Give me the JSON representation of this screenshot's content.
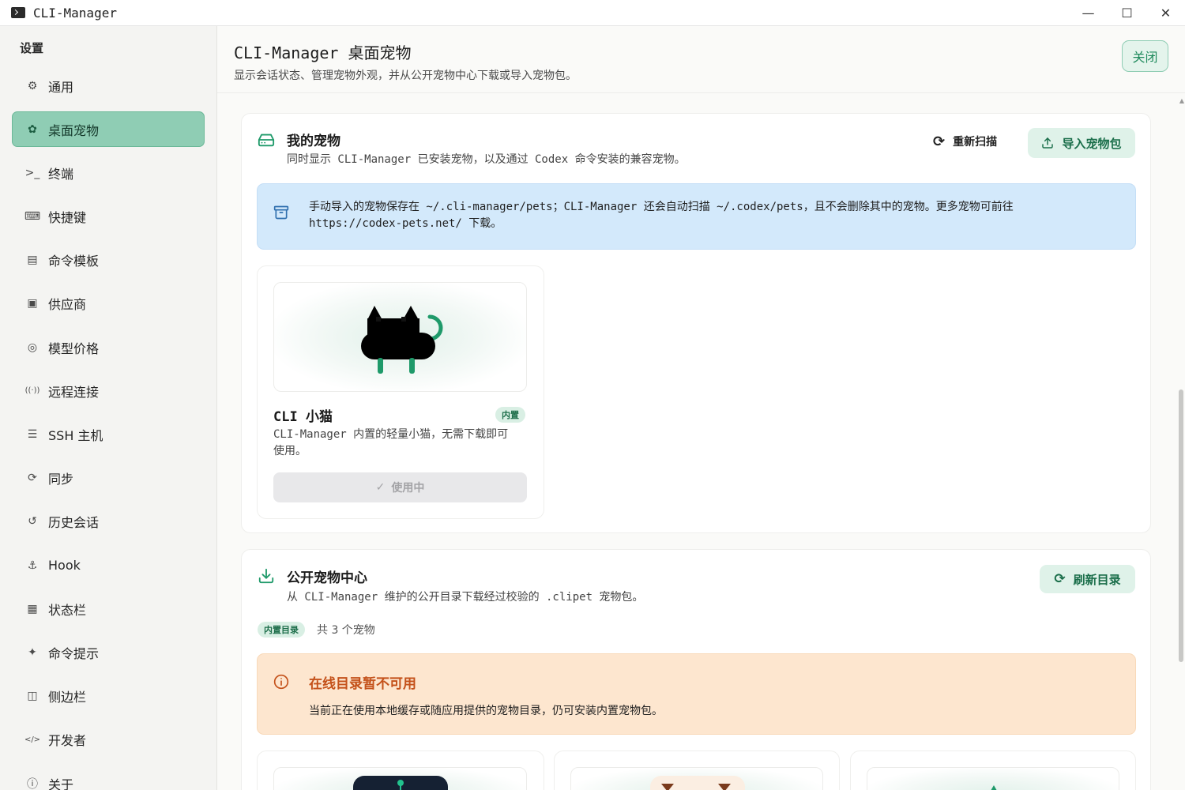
{
  "window": {
    "title": "CLI-Manager",
    "controls": {
      "minimize": "—",
      "maximize": "☐",
      "close": "✕"
    }
  },
  "sidebar": {
    "heading": "设置",
    "items": [
      {
        "label": "通用",
        "icon": "sliders-icon",
        "glyph": "⚙"
      },
      {
        "label": "桌面宠物",
        "icon": "paw-icon",
        "glyph": "✿",
        "active": true
      },
      {
        "label": "终端",
        "icon": "terminal-icon",
        "glyph": ">_"
      },
      {
        "label": "快捷键",
        "icon": "keyboard-icon",
        "glyph": "⌨"
      },
      {
        "label": "命令模板",
        "icon": "clipboard-icon",
        "glyph": "▤"
      },
      {
        "label": "供应商",
        "icon": "provider-icon",
        "glyph": "▣"
      },
      {
        "label": "模型价格",
        "icon": "price-tag-icon",
        "glyph": "◎"
      },
      {
        "label": "远程连接",
        "icon": "antenna-icon",
        "glyph": "((·))"
      },
      {
        "label": "SSH 主机",
        "icon": "server-icon",
        "glyph": "☰"
      },
      {
        "label": "同步",
        "icon": "sync-icon",
        "glyph": "⟳"
      },
      {
        "label": "历史会话",
        "icon": "history-icon",
        "glyph": "↺"
      },
      {
        "label": "Hook",
        "icon": "hook-icon",
        "glyph": "⚓"
      },
      {
        "label": "状态栏",
        "icon": "layout-icon",
        "glyph": "▦"
      },
      {
        "label": "命令提示",
        "icon": "sparkle-icon",
        "glyph": "✦"
      },
      {
        "label": "侧边栏",
        "icon": "sidebar-icon",
        "glyph": "◫"
      },
      {
        "label": "开发者",
        "icon": "code-icon",
        "glyph": "</>"
      },
      {
        "label": "关于",
        "icon": "info-icon",
        "glyph": "ⓘ"
      }
    ]
  },
  "header": {
    "title": "CLI-Manager 桌面宠物",
    "subtitle": "显示会话状态、管理宠物外观，并从公开宠物中心下载或导入宠物包。",
    "close_label": "关闭"
  },
  "my_pets": {
    "title": "我的宠物",
    "description": "同时显示 CLI-Manager 已安装宠物，以及通过 Codex 命令安装的兼容宠物。",
    "rescan_label": "重新扫描",
    "import_label": "导入宠物包",
    "info_line1": "手动导入的宠物保存在 ~/.cli-manager/pets；CLI-Manager 还会自动扫描 ~/.codex/pets，且不会删除其中的宠物。更多宠物可前往",
    "info_line2": "https://codex-pets.net/ 下载。",
    "pet": {
      "name": "CLI 小猫",
      "badge": "内置",
      "desc_line1": "CLI-Manager 内置的轻量小猫，无需下载即可",
      "desc_line2": "使用。",
      "status_label": "使用中"
    }
  },
  "public_center": {
    "title": "公开宠物中心",
    "description": "从 CLI-Manager 维护的公开目录下载经过校验的 .clipet 宠物包。",
    "refresh_label": "刷新目录",
    "catalog_badge": "内置目录",
    "count_text": "共 3 个宠物",
    "warning_title": "在线目录暂不可用",
    "warning_text": "当前正在使用本地缓存或随应用提供的宠物目录，仍可安装内置宠物包。"
  },
  "colors": {
    "accent": "#1f9a6a",
    "active_nav": "#8fcdb4",
    "info_bg": "#d3e9fb",
    "warn_bg": "#fde6cf",
    "warn_text": "#c4511a"
  }
}
